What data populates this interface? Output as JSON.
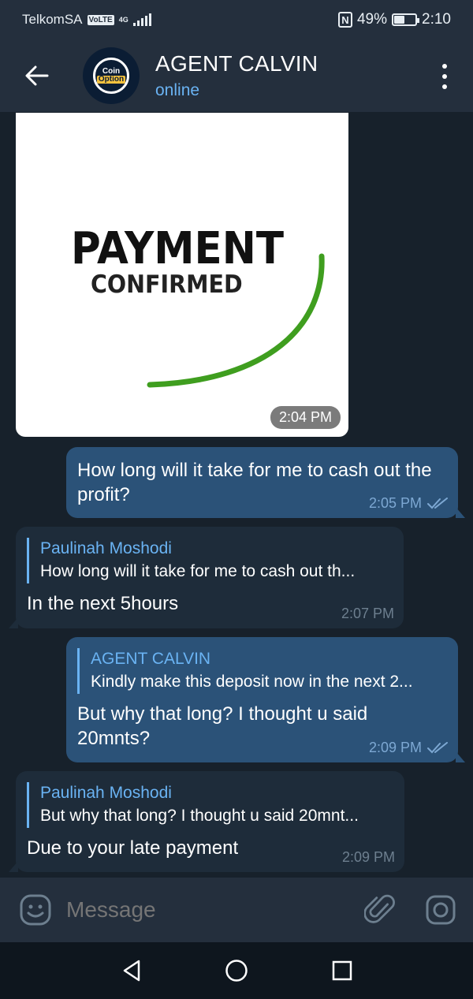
{
  "status_bar": {
    "carrier": "TelkomSA",
    "volte": "VoLTE",
    "network": "4G",
    "battery": "49%",
    "battery_level": 0.49,
    "time": "2:10"
  },
  "header": {
    "title": "AGENT CALVIN",
    "status": "online",
    "avatar_logo_line1": "Coin",
    "avatar_logo_line2": "Option"
  },
  "image_message": {
    "heading": "PAYMENT",
    "subheading": "CONFIRMED",
    "time": "2:04 PM"
  },
  "messages": [
    {
      "direction": "out",
      "text": "How long will it take for me to cash out the profit?",
      "time": "2:05 PM",
      "read": true
    },
    {
      "direction": "in",
      "reply_name": "Paulinah Moshodi",
      "reply_text": "How long will it take for me to cash out th...",
      "text": "In the next 5hours",
      "time": "2:07 PM"
    },
    {
      "direction": "out",
      "reply_name": "AGENT CALVIN",
      "reply_text": "Kindly make this deposit now in the next 2...",
      "text": "But why that long? I thought u said 20mnts?",
      "time": "2:09 PM",
      "read": true
    },
    {
      "direction": "in",
      "reply_name": "Paulinah Moshodi",
      "reply_text": "But why that long? I thought u said 20mnt...",
      "text": "Due to your late payment",
      "time": "2:09 PM"
    }
  ],
  "input": {
    "placeholder": "Message"
  },
  "colors": {
    "background": "#17212b",
    "header": "#242f3d",
    "outgoing_bubble": "#2b5278",
    "incoming_bubble": "#1e2c3a",
    "accent": "#6ab3f3",
    "confirm_arc": "#3f9e1f"
  }
}
